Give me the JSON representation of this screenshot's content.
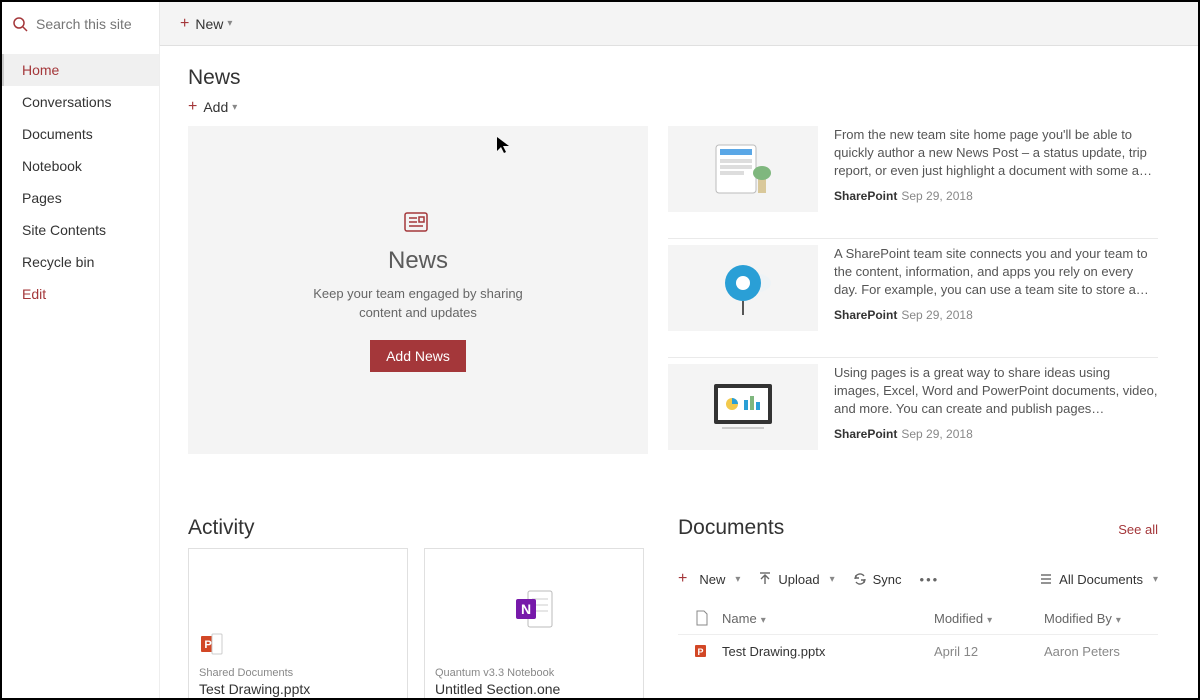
{
  "search": {
    "placeholder": "Search this site"
  },
  "topbar": {
    "new_label": "New"
  },
  "sidebar": {
    "items": [
      {
        "label": "Home",
        "active": true
      },
      {
        "label": "Conversations"
      },
      {
        "label": "Documents"
      },
      {
        "label": "Notebook"
      },
      {
        "label": "Pages"
      },
      {
        "label": "Site Contents"
      },
      {
        "label": "Recycle bin"
      }
    ],
    "edit_label": "Edit"
  },
  "news": {
    "section_title": "News",
    "add_label": "Add",
    "hero_title": "News",
    "hero_desc": "Keep your team engaged by sharing content and updates",
    "hero_button": "Add News",
    "items": [
      {
        "excerpt": "From the new team site home page you'll be able to quickly author a new News Post – a status update, trip report, or even just highlight a document with some a…",
        "author": "SharePoint",
        "date": "Sep 29, 2018",
        "thumb": "tablet"
      },
      {
        "excerpt": "A SharePoint team site connects you and your team to the content, information, and apps you rely on every day. For example, you can use a team site to store a…",
        "author": "SharePoint",
        "date": "Sep 29, 2018",
        "thumb": "bulb"
      },
      {
        "excerpt": "Using pages is a great way to share ideas using images, Excel, Word and PowerPoint documents, video, and more. You can create and publish pages…",
        "author": "SharePoint",
        "date": "Sep 29, 2018",
        "thumb": "monitor"
      }
    ]
  },
  "activity": {
    "section_title": "Activity",
    "cards": [
      {
        "library": "Shared Documents",
        "name": "Test Drawing.pptx",
        "type": "pptx"
      },
      {
        "library": "Quantum v3.3 Notebook",
        "name": "Untitled Section.one",
        "type": "onenote"
      }
    ]
  },
  "documents": {
    "section_title": "Documents",
    "see_all": "See all",
    "toolbar": {
      "new": "New",
      "upload": "Upload",
      "sync": "Sync"
    },
    "view_label": "All Documents",
    "columns": {
      "name": "Name",
      "modified": "Modified",
      "modified_by": "Modified By"
    },
    "rows": [
      {
        "name": "Test Drawing.pptx",
        "modified": "April 12",
        "modified_by": "Aaron Peters",
        "type": "pptx"
      }
    ]
  }
}
